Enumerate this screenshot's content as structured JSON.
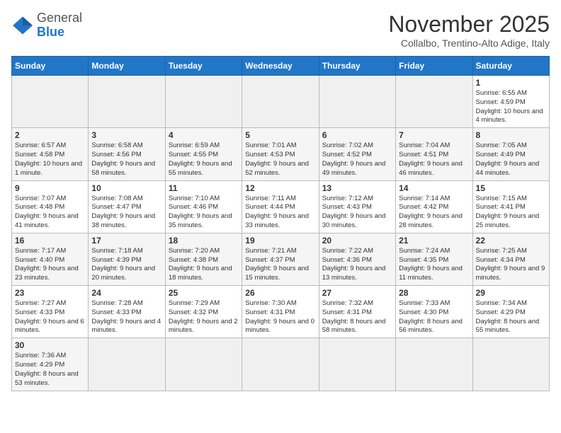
{
  "header": {
    "logo_general": "General",
    "logo_blue": "Blue",
    "month_title": "November 2025",
    "subtitle": "Collalbo, Trentino-Alto Adige, Italy"
  },
  "weekdays": [
    "Sunday",
    "Monday",
    "Tuesday",
    "Wednesday",
    "Thursday",
    "Friday",
    "Saturday"
  ],
  "weeks": [
    [
      {
        "day": "",
        "info": ""
      },
      {
        "day": "",
        "info": ""
      },
      {
        "day": "",
        "info": ""
      },
      {
        "day": "",
        "info": ""
      },
      {
        "day": "",
        "info": ""
      },
      {
        "day": "",
        "info": ""
      },
      {
        "day": "1",
        "info": "Sunrise: 6:55 AM\nSunset: 4:59 PM\nDaylight: 10 hours and 4 minutes."
      }
    ],
    [
      {
        "day": "2",
        "info": "Sunrise: 6:57 AM\nSunset: 4:58 PM\nDaylight: 10 hours and 1 minute."
      },
      {
        "day": "3",
        "info": "Sunrise: 6:58 AM\nSunset: 4:56 PM\nDaylight: 9 hours and 58 minutes."
      },
      {
        "day": "4",
        "info": "Sunrise: 6:59 AM\nSunset: 4:55 PM\nDaylight: 9 hours and 55 minutes."
      },
      {
        "day": "5",
        "info": "Sunrise: 7:01 AM\nSunset: 4:53 PM\nDaylight: 9 hours and 52 minutes."
      },
      {
        "day": "6",
        "info": "Sunrise: 7:02 AM\nSunset: 4:52 PM\nDaylight: 9 hours and 49 minutes."
      },
      {
        "day": "7",
        "info": "Sunrise: 7:04 AM\nSunset: 4:51 PM\nDaylight: 9 hours and 46 minutes."
      },
      {
        "day": "8",
        "info": "Sunrise: 7:05 AM\nSunset: 4:49 PM\nDaylight: 9 hours and 44 minutes."
      }
    ],
    [
      {
        "day": "9",
        "info": "Sunrise: 7:07 AM\nSunset: 4:48 PM\nDaylight: 9 hours and 41 minutes."
      },
      {
        "day": "10",
        "info": "Sunrise: 7:08 AM\nSunset: 4:47 PM\nDaylight: 9 hours and 38 minutes."
      },
      {
        "day": "11",
        "info": "Sunrise: 7:10 AM\nSunset: 4:46 PM\nDaylight: 9 hours and 35 minutes."
      },
      {
        "day": "12",
        "info": "Sunrise: 7:11 AM\nSunset: 4:44 PM\nDaylight: 9 hours and 33 minutes."
      },
      {
        "day": "13",
        "info": "Sunrise: 7:12 AM\nSunset: 4:43 PM\nDaylight: 9 hours and 30 minutes."
      },
      {
        "day": "14",
        "info": "Sunrise: 7:14 AM\nSunset: 4:42 PM\nDaylight: 9 hours and 28 minutes."
      },
      {
        "day": "15",
        "info": "Sunrise: 7:15 AM\nSunset: 4:41 PM\nDaylight: 9 hours and 25 minutes."
      }
    ],
    [
      {
        "day": "16",
        "info": "Sunrise: 7:17 AM\nSunset: 4:40 PM\nDaylight: 9 hours and 23 minutes."
      },
      {
        "day": "17",
        "info": "Sunrise: 7:18 AM\nSunset: 4:39 PM\nDaylight: 9 hours and 20 minutes."
      },
      {
        "day": "18",
        "info": "Sunrise: 7:20 AM\nSunset: 4:38 PM\nDaylight: 9 hours and 18 minutes."
      },
      {
        "day": "19",
        "info": "Sunrise: 7:21 AM\nSunset: 4:37 PM\nDaylight: 9 hours and 15 minutes."
      },
      {
        "day": "20",
        "info": "Sunrise: 7:22 AM\nSunset: 4:36 PM\nDaylight: 9 hours and 13 minutes."
      },
      {
        "day": "21",
        "info": "Sunrise: 7:24 AM\nSunset: 4:35 PM\nDaylight: 9 hours and 11 minutes."
      },
      {
        "day": "22",
        "info": "Sunrise: 7:25 AM\nSunset: 4:34 PM\nDaylight: 9 hours and 9 minutes."
      }
    ],
    [
      {
        "day": "23",
        "info": "Sunrise: 7:27 AM\nSunset: 4:33 PM\nDaylight: 9 hours and 6 minutes."
      },
      {
        "day": "24",
        "info": "Sunrise: 7:28 AM\nSunset: 4:33 PM\nDaylight: 9 hours and 4 minutes."
      },
      {
        "day": "25",
        "info": "Sunrise: 7:29 AM\nSunset: 4:32 PM\nDaylight: 9 hours and 2 minutes."
      },
      {
        "day": "26",
        "info": "Sunrise: 7:30 AM\nSunset: 4:31 PM\nDaylight: 9 hours and 0 minutes."
      },
      {
        "day": "27",
        "info": "Sunrise: 7:32 AM\nSunset: 4:31 PM\nDaylight: 8 hours and 58 minutes."
      },
      {
        "day": "28",
        "info": "Sunrise: 7:33 AM\nSunset: 4:30 PM\nDaylight: 8 hours and 56 minutes."
      },
      {
        "day": "29",
        "info": "Sunrise: 7:34 AM\nSunset: 4:29 PM\nDaylight: 8 hours and 55 minutes."
      }
    ],
    [
      {
        "day": "30",
        "info": "Sunrise: 7:36 AM\nSunset: 4:29 PM\nDaylight: 8 hours and 53 minutes."
      },
      {
        "day": "",
        "info": ""
      },
      {
        "day": "",
        "info": ""
      },
      {
        "day": "",
        "info": ""
      },
      {
        "day": "",
        "info": ""
      },
      {
        "day": "",
        "info": ""
      },
      {
        "day": "",
        "info": ""
      }
    ]
  ]
}
